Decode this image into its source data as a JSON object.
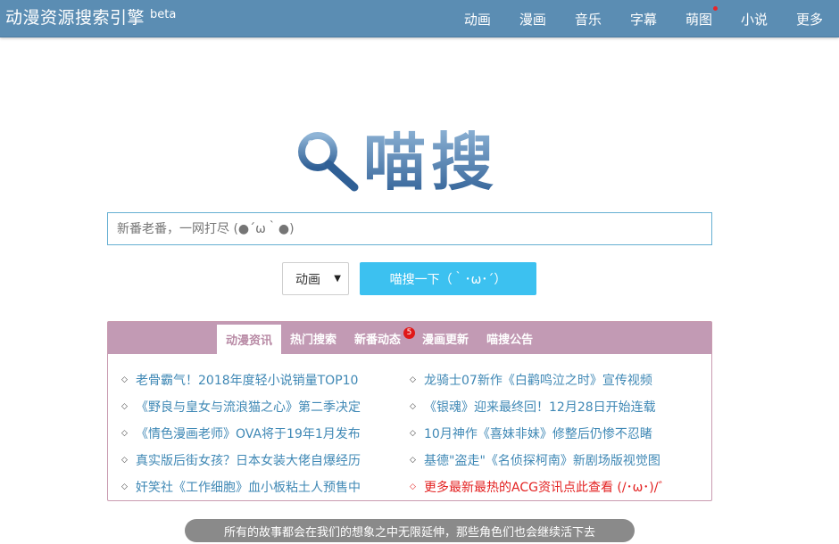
{
  "site": {
    "title": "动漫资源搜索引擎",
    "beta": "beta"
  },
  "nav": {
    "items": [
      {
        "label": "动画"
      },
      {
        "label": "漫画"
      },
      {
        "label": "音乐"
      },
      {
        "label": "字幕"
      },
      {
        "label": "萌图",
        "has_dot": true
      },
      {
        "label": "小说"
      },
      {
        "label": "更多"
      }
    ]
  },
  "logo": {
    "text": "喵搜",
    "icon": "magnifier-icon"
  },
  "search": {
    "value": "",
    "placeholder": "新番老番，一网打尽 (●´ω｀●)",
    "category_selected": "动画",
    "button_label": "喵搜一下（｀･ω･´）"
  },
  "news_panel": {
    "tabs": [
      {
        "label": "动漫资讯",
        "active": true
      },
      {
        "label": "热门搜索"
      },
      {
        "label": "新番动态",
        "badge": "5"
      },
      {
        "label": "漫画更新"
      },
      {
        "label": "喵搜公告"
      }
    ],
    "left_items": [
      "老骨霸气！2018年度轻小说销量TOP10",
      "《野良与皇女与流浪猫之心》第二季决定",
      "《情色漫画老师》OVA将于19年1月发布",
      "真实版后街女孩？日本女装大佬自爆经历",
      "奸笑社《工作细胞》血小板粘土人预售中"
    ],
    "right_items": [
      "龙骑士07新作《白鹳鸣泣之时》宣传视频",
      "《银魂》迎来最终回！12月28日开始连载",
      "10月神作《喜妹非妹》修整后仍惨不忍睹",
      "基德\"盗走\"《名侦探柯南》新剧场版视觉图"
    ],
    "more_link": "更多最新最热的ACG资讯点此查看 (/･ω･)/゛"
  },
  "tagline": "所有的故事都会在我们的想象之中无限延伸，那些角色们也会继续活下去",
  "colors": {
    "topbar": "#5b8db3",
    "search_button": "#3cc1f0",
    "tab_bar": "#c29ab4",
    "link": "#3f88b5",
    "highlight_link": "#e32222",
    "badge": "#e01818"
  }
}
